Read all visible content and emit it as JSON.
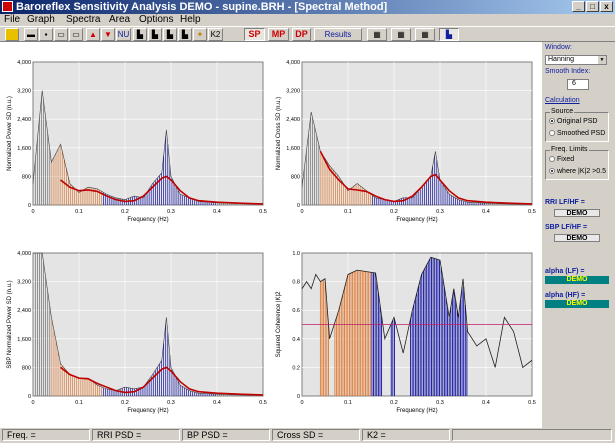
{
  "window": {
    "title": "Baroreflex Sensitivity Analysis DEMO - supine.BRH - [Spectral Method]"
  },
  "menu": [
    "File",
    "Graph",
    "Spectra",
    "Area",
    "Options",
    "Help"
  ],
  "toolbar": {
    "nu_label": "NU",
    "k2_label": "K2",
    "sp_label": "SP",
    "mp_label": "MP",
    "dp_label": "DP",
    "results_label": "Results"
  },
  "plots": {
    "top_left_ylabel": "Normalized Power SD (n.u.)",
    "top_right_ylabel": "Normalized Cross SD (n.u.)",
    "bottom_left_ylabel": "SBP Normalized Power SD (n.u.)",
    "bottom_right_ylabel": "Squared Coherence |K|2",
    "xlabel": "Frequency (Hz)",
    "y_ticks_psd": [
      "4,000",
      "3,200",
      "2,400",
      "1,600",
      "800",
      "0"
    ],
    "y_ticks_coh": [
      "1.0",
      "0.8",
      "0.6",
      "0.4",
      "0.2",
      "0"
    ],
    "x_ticks": [
      "0",
      "0.1",
      "0.2",
      "0.3",
      "0.4",
      "0.5"
    ]
  },
  "chart_data": [
    {
      "type": "area",
      "ylabel": "Normalized Power SD (n.u.)",
      "xlabel": "Frequency (Hz)",
      "xlim": [
        0,
        0.5
      ],
      "ylim": [
        0,
        4000
      ],
      "x": [
        0,
        0.02,
        0.04,
        0.06,
        0.08,
        0.1,
        0.12,
        0.14,
        0.16,
        0.18,
        0.2,
        0.22,
        0.24,
        0.26,
        0.28,
        0.29,
        0.3,
        0.32,
        0.34,
        0.36,
        0.4,
        0.45,
        0.5
      ],
      "series": [
        {
          "values": [
            600,
            3200,
            1200,
            1700,
            600,
            350,
            500,
            450,
            300,
            200,
            150,
            250,
            200,
            600,
            900,
            2100,
            800,
            300,
            200,
            100,
            60,
            40,
            20
          ]
        },
        {
          "values": [
            0,
            0,
            0,
            700,
            500,
            400,
            420,
            380,
            250,
            150,
            100,
            120,
            250,
            500,
            750,
            800,
            700,
            400,
            200,
            120,
            80,
            50,
            30
          ]
        }
      ]
    },
    {
      "type": "area",
      "ylabel": "Normalized Cross SD (n.u.)",
      "xlabel": "Frequency (Hz)",
      "xlim": [
        0,
        0.5
      ],
      "ylim": [
        0,
        4000
      ],
      "x": [
        0,
        0.02,
        0.04,
        0.06,
        0.08,
        0.1,
        0.12,
        0.14,
        0.16,
        0.18,
        0.2,
        0.22,
        0.24,
        0.26,
        0.28,
        0.29,
        0.3,
        0.32,
        0.34,
        0.36,
        0.4,
        0.45,
        0.5
      ],
      "series": [
        {
          "values": [
            500,
            2600,
            1500,
            1100,
            800,
            400,
            600,
            400,
            200,
            150,
            100,
            200,
            200,
            500,
            800,
            1500,
            700,
            300,
            150,
            80,
            50,
            30,
            20
          ]
        },
        {
          "values": [
            0,
            0,
            1500,
            1000,
            700,
            450,
            420,
            380,
            250,
            150,
            100,
            120,
            250,
            500,
            800,
            850,
            700,
            400,
            200,
            120,
            80,
            50,
            30
          ]
        }
      ]
    },
    {
      "type": "area",
      "ylabel": "SBP Normalized Power SD (n.u.)",
      "xlabel": "Frequency (Hz)",
      "xlim": [
        0,
        0.5
      ],
      "ylim": [
        0,
        4000
      ],
      "x": [
        0,
        0.02,
        0.04,
        0.06,
        0.08,
        0.1,
        0.12,
        0.14,
        0.16,
        0.18,
        0.2,
        0.22,
        0.24,
        0.26,
        0.28,
        0.29,
        0.3,
        0.32,
        0.34,
        0.36,
        0.4,
        0.45,
        0.5
      ],
      "series": [
        {
          "values": [
            4000,
            4000,
            2200,
            900,
            600,
            500,
            500,
            300,
            200,
            150,
            250,
            200,
            250,
            600,
            1000,
            2200,
            800,
            300,
            150,
            80,
            50,
            30,
            20
          ]
        },
        {
          "values": [
            0,
            0,
            0,
            800,
            600,
            500,
            480,
            350,
            250,
            150,
            100,
            120,
            250,
            500,
            750,
            800,
            700,
            400,
            200,
            120,
            80,
            50,
            30
          ]
        }
      ]
    },
    {
      "type": "line",
      "ylabel": "Squared Coherence |K|2",
      "xlabel": "Frequency (Hz)",
      "xlim": [
        0,
        0.5
      ],
      "ylim": [
        0,
        1.0
      ],
      "threshold": 0.5,
      "x": [
        0,
        0.01,
        0.02,
        0.03,
        0.04,
        0.05,
        0.06,
        0.08,
        0.1,
        0.12,
        0.14,
        0.16,
        0.18,
        0.2,
        0.22,
        0.24,
        0.26,
        0.28,
        0.3,
        0.32,
        0.33,
        0.34,
        0.35,
        0.36,
        0.38,
        0.4,
        0.42,
        0.44,
        0.46,
        0.48,
        0.5
      ],
      "series": [
        {
          "values": [
            0.75,
            0.8,
            0.75,
            0.85,
            0.8,
            0.82,
            0.4,
            0.6,
            0.85,
            0.88,
            0.87,
            0.86,
            0.4,
            0.55,
            0.3,
            0.6,
            0.85,
            0.97,
            0.95,
            0.55,
            0.75,
            0.55,
            0.82,
            0.45,
            0.35,
            0.4,
            0.2,
            0.55,
            0.45,
            0.2,
            0.25
          ]
        }
      ]
    }
  ],
  "right_panel": {
    "window_label": "Window:",
    "window_value": "Hanning",
    "smooth_label": "Smooth Index:",
    "smooth_value": "6",
    "calculation_label": "Calculation",
    "source_label": "Source",
    "source_opt1": "Original PSD",
    "source_opt2": "Smoothed PSD",
    "freq_label": "Freq. Limits",
    "freq_opt1": "Fixed",
    "freq_opt2": "where |K|2 >0.5",
    "rri_label": "RRI LF/HF =",
    "sbp_label": "SBP LF/HF =",
    "alpha_lf_label": "alpha (LF) =",
    "alpha_hf_label": "alpha (HF) =",
    "demo_value": "DEMO"
  },
  "status": {
    "freq": "Freq. =",
    "rri_psd": "RRI PSD =",
    "bp_psd": "BP PSD =",
    "cross_sd": "Cross SD =",
    "k2": "K2 ="
  },
  "colors": {
    "lf": "#e07830",
    "hf": "#1010a0",
    "smooth": "#c00000",
    "threshold": "#c0206a",
    "demo_bg": "#008080",
    "demo_fg": "#ffff00"
  }
}
